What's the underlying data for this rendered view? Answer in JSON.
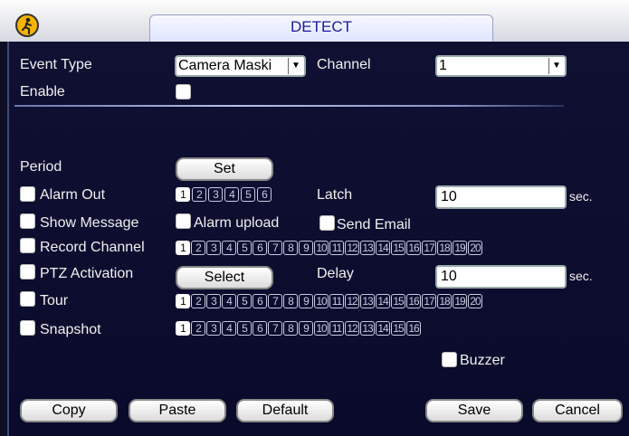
{
  "window": {
    "title": "DETECT"
  },
  "event_type": {
    "label": "Event Type",
    "value": "Camera Maski"
  },
  "channel": {
    "label": "Channel",
    "value": "1"
  },
  "enable": {
    "label": "Enable"
  },
  "period": {
    "label": "Period",
    "button": "Set"
  },
  "alarm_out": {
    "label": "Alarm Out",
    "numbers": [
      "1",
      "2",
      "3",
      "4",
      "5",
      "6"
    ],
    "selected": [
      "1"
    ]
  },
  "latch": {
    "label": "Latch",
    "value": "10",
    "unit": "sec."
  },
  "show_message": {
    "label": "Show Message"
  },
  "alarm_upload": {
    "label": "Alarm upload"
  },
  "send_email": {
    "label": "Send Email"
  },
  "record_channel": {
    "label": "Record Channel",
    "numbers": [
      "1",
      "2",
      "3",
      "4",
      "5",
      "6",
      "7",
      "8",
      "9",
      "10",
      "11",
      "12",
      "13",
      "14",
      "15",
      "16",
      "17",
      "18",
      "19",
      "20"
    ],
    "selected": [
      "1"
    ]
  },
  "ptz": {
    "label": "PTZ Activation",
    "button": "Select"
  },
  "delay": {
    "label": "Delay",
    "value": "10",
    "unit": "sec."
  },
  "tour": {
    "label": "Tour",
    "numbers": [
      "1",
      "2",
      "3",
      "4",
      "5",
      "6",
      "7",
      "8",
      "9",
      "10",
      "11",
      "12",
      "13",
      "14",
      "15",
      "16",
      "17",
      "18",
      "19",
      "20"
    ],
    "selected": [
      "1"
    ]
  },
  "snapshot": {
    "label": "Snapshot",
    "numbers": [
      "1",
      "2",
      "3",
      "4",
      "5",
      "6",
      "7",
      "8",
      "9",
      "10",
      "11",
      "12",
      "13",
      "14",
      "15",
      "16"
    ],
    "selected": [
      "1"
    ]
  },
  "buzzer": {
    "label": "Buzzer"
  },
  "buttons": {
    "copy": "Copy",
    "paste": "Paste",
    "default": "Default",
    "save": "Save",
    "cancel": "Cancel"
  }
}
